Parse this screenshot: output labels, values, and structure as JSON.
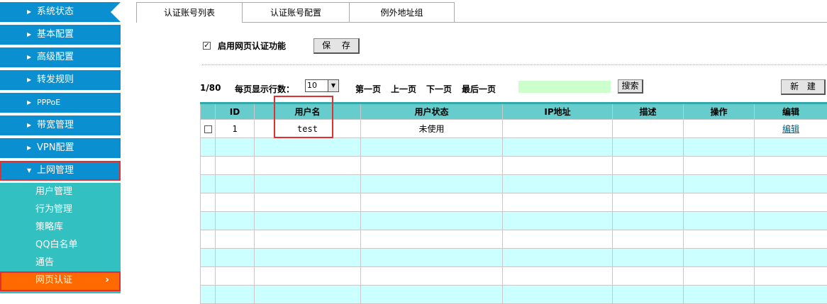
{
  "sidebar": {
    "items": [
      {
        "label": "系统状态"
      },
      {
        "label": "基本配置"
      },
      {
        "label": "高级配置"
      },
      {
        "label": "转发规则"
      },
      {
        "label": "PPPoE"
      },
      {
        "label": "带宽管理"
      },
      {
        "label": "VPN配置"
      },
      {
        "label": "上网管理"
      }
    ],
    "arrow": "▶",
    "active_arrow": "▼",
    "submenu": [
      {
        "label": "用户管理"
      },
      {
        "label": "行为管理"
      },
      {
        "label": "策略库"
      },
      {
        "label": "QQ白名单"
      },
      {
        "label": "通告"
      },
      {
        "label": "网页认证"
      }
    ],
    "submenu_chevron": "›"
  },
  "tabs": [
    {
      "label": "认证账号列表"
    },
    {
      "label": "认证账号配置"
    },
    {
      "label": "例外地址组"
    }
  ],
  "enable": {
    "checked_mark": "✓",
    "label": "启用网页认证功能",
    "save_label": "保 存"
  },
  "pager": {
    "page_info": "1/80",
    "rows_label": "每页显示行数：",
    "rows_value": "10",
    "first": "第一页",
    "prev": "上一页",
    "next": "下一页",
    "last": "最后一页",
    "search_label": "搜索",
    "new_label": "新 建"
  },
  "table": {
    "headers": [
      "ID",
      "用户名",
      "用户状态",
      "IP地址",
      "描述",
      "操作",
      "编辑"
    ],
    "rows": [
      {
        "id": "1",
        "username": "test",
        "status": "未使用",
        "ip": "",
        "desc": "",
        "op": "",
        "edit": "编辑"
      }
    ]
  },
  "colors": {
    "nav_bg": "#0a8fd0",
    "submenu_bg": "#33c0c0",
    "active_sub_bg": "#ff6a00",
    "highlight": "#e03030",
    "table_header": "#66cccc",
    "row_alt": "#ccffff"
  }
}
